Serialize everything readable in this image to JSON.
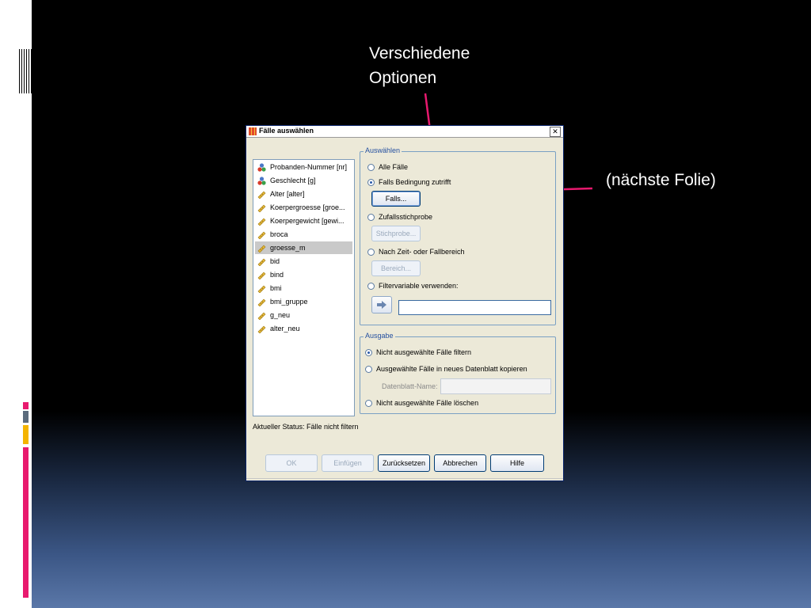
{
  "slide": {
    "annotation_top": "Verschiedene\nOptionen",
    "annotation_right": "(nächste Folie)",
    "accent_color": "#e8196e"
  },
  "dialog": {
    "title": "Fälle auswählen",
    "variables": [
      {
        "label": "Probanden-Nummer [nr]",
        "icon": "nominal-variable-icon"
      },
      {
        "label": "Geschlecht [g]",
        "icon": "nominal-variable-icon"
      },
      {
        "label": "Alter [alter]",
        "icon": "scale-variable-icon"
      },
      {
        "label": "Koerpergroesse [groe...",
        "icon": "scale-variable-icon"
      },
      {
        "label": "Koerpergewicht [gewi...",
        "icon": "scale-variable-icon"
      },
      {
        "label": "broca",
        "icon": "scale-variable-icon"
      },
      {
        "label": "groesse_m",
        "icon": "scale-variable-icon",
        "selected": true
      },
      {
        "label": "bid",
        "icon": "scale-variable-icon"
      },
      {
        "label": "bind",
        "icon": "scale-variable-icon"
      },
      {
        "label": "bmi",
        "icon": "scale-variable-icon"
      },
      {
        "label": "bmi_gruppe",
        "icon": "scale-variable-icon"
      },
      {
        "label": "g_neu",
        "icon": "scale-variable-icon"
      },
      {
        "label": "alter_neu",
        "icon": "scale-variable-icon"
      }
    ],
    "select_group": {
      "legend": "Auswählen",
      "all_cases": "Alle Fälle",
      "if_condition": "Falls Bedingung zutrifft",
      "if_button": "Falls...",
      "random_sample": "Zufallsstichprobe",
      "sample_button": "Stichprobe...",
      "range": "Nach Zeit- oder Fallbereich",
      "range_button": "Bereich...",
      "filter_variable": "Filtervariable verwenden:",
      "selected_option": "Falls Bedingung zutrifft"
    },
    "output_group": {
      "legend": "Ausgabe",
      "filter_out": "Nicht ausgewählte Fälle filtern",
      "copy": "Ausgewählte Fälle in neues Datenblatt kopieren",
      "dataset_name_label": "Datenblatt-Name:",
      "delete": "Nicht ausgewählte Fälle löschen",
      "selected_option": "Nicht ausgewählte Fälle filtern"
    },
    "status": "Aktueller Status: Fälle nicht filtern",
    "buttons": {
      "ok": "OK",
      "paste": "Einfügen",
      "reset": "Zurücksetzen",
      "cancel": "Abbrechen",
      "help": "Hilfe"
    }
  }
}
